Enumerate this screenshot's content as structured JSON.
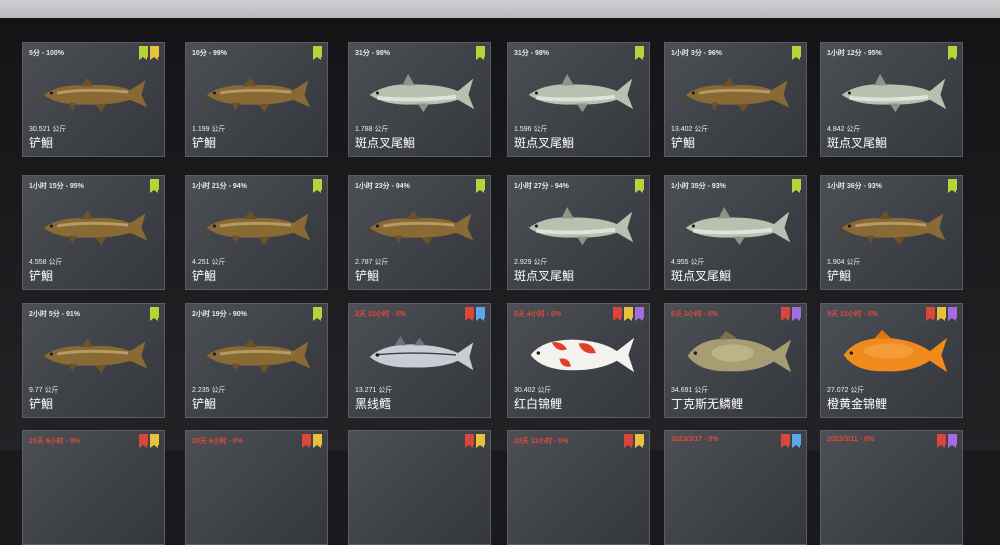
{
  "cards": [
    {
      "time": "5分 - 100%",
      "weight": "30.521 公斤",
      "name": "铲鮰",
      "fish": "catfish",
      "time_color": "white",
      "badges": [
        "green",
        "yellow"
      ]
    },
    {
      "time": "10分 - 99%",
      "weight": "1.199 公斤",
      "name": "铲鮰",
      "fish": "catfish",
      "time_color": "white",
      "badges": [
        "green"
      ]
    },
    {
      "time": "31分 - 98%",
      "weight": "1.788 公斤",
      "name": "斑点叉尾鮰",
      "fish": "channel-catfish",
      "time_color": "white",
      "badges": [
        "green"
      ]
    },
    {
      "time": "31分 - 98%",
      "weight": "1.596 公斤",
      "name": "斑点叉尾鮰",
      "fish": "channel-catfish",
      "time_color": "white",
      "badges": [
        "green"
      ]
    },
    {
      "time": "1小时 3分 - 96%",
      "weight": "13.402 公斤",
      "name": "铲鮰",
      "fish": "catfish",
      "time_color": "white",
      "badges": [
        "green"
      ]
    },
    {
      "time": "1小时 12分 - 95%",
      "weight": "4.842 公斤",
      "name": "斑点叉尾鮰",
      "fish": "channel-catfish",
      "time_color": "white",
      "badges": [
        "green"
      ]
    },
    {
      "time": "1小时 15分 - 95%",
      "weight": "4.558 公斤",
      "name": "铲鮰",
      "fish": "catfish",
      "time_color": "white",
      "badges": [
        "green"
      ]
    },
    {
      "time": "1小时 21分 - 94%",
      "weight": "4.251 公斤",
      "name": "铲鮰",
      "fish": "catfish",
      "time_color": "white",
      "badges": [
        "green"
      ]
    },
    {
      "time": "1小时 23分 - 94%",
      "weight": "2.787 公斤",
      "name": "铲鮰",
      "fish": "catfish",
      "time_color": "white",
      "badges": [
        "green"
      ]
    },
    {
      "time": "1小时 27分 - 94%",
      "weight": "2.929 公斤",
      "name": "斑点叉尾鮰",
      "fish": "channel-catfish",
      "time_color": "white",
      "badges": [
        "green"
      ]
    },
    {
      "time": "1小时 35分 - 93%",
      "weight": "4.955 公斤",
      "name": "斑点叉尾鮰",
      "fish": "channel-catfish",
      "time_color": "white",
      "badges": [
        "green"
      ]
    },
    {
      "time": "1小时 36分 - 93%",
      "weight": "1.904 公斤",
      "name": "铲鮰",
      "fish": "catfish",
      "time_color": "white",
      "badges": [
        "green"
      ]
    },
    {
      "time": "2小时 5分 - 91%",
      "weight": "9.77 公斤",
      "name": "铲鮰",
      "fish": "catfish",
      "time_color": "white",
      "badges": [
        "green"
      ]
    },
    {
      "time": "2小时 19分 - 90%",
      "weight": "2.235 公斤",
      "name": "铲鮰",
      "fish": "catfish",
      "time_color": "white",
      "badges": [
        "green"
      ]
    },
    {
      "time": "2天 10小时 - 0%",
      "weight": "13.271 公斤",
      "name": "黑线鳕",
      "fish": "haddock",
      "time_color": "red",
      "badges": [
        "red",
        "blue"
      ]
    },
    {
      "time": "5天 4小时 - 0%",
      "weight": "30.402 公斤",
      "name": "红白锦鲤",
      "fish": "koi",
      "time_color": "red",
      "badges": [
        "red",
        "yellow",
        "purple"
      ]
    },
    {
      "time": "6天 3小时 - 0%",
      "weight": "34.691 公斤",
      "name": "丁克斯无鳞鲤",
      "fish": "carp",
      "time_color": "red",
      "badges": [
        "red",
        "purple"
      ]
    },
    {
      "time": "9天 13小时 - 0%",
      "weight": "27.072 公斤",
      "name": "橙黄金锦鲤",
      "fish": "orange-koi",
      "time_color": "red",
      "badges": [
        "red",
        "yellow",
        "purple"
      ]
    },
    {
      "time": "20天 6小时 - 0%",
      "weight": "",
      "name": "",
      "fish": "none",
      "time_color": "red",
      "badges": [
        "red",
        "yellow"
      ]
    },
    {
      "time": "20天 6小时 - 0%",
      "weight": "",
      "name": "",
      "fish": "none",
      "time_color": "red",
      "badges": [
        "red",
        "yellow"
      ]
    },
    {
      "time": "",
      "weight": "",
      "name": "",
      "fish": "none",
      "time_color": "red",
      "badges": [
        "red",
        "yellow"
      ]
    },
    {
      "time": "20天 11小时 - 0%",
      "weight": "",
      "name": "",
      "fish": "none",
      "time_color": "red",
      "badges": [
        "red",
        "yellow"
      ]
    },
    {
      "time": "2023/3/17 - 0%",
      "weight": "",
      "name": "",
      "fish": "none",
      "time_color": "red",
      "badges": [
        "red",
        "blue"
      ]
    },
    {
      "time": "2023/3/11 - 0%",
      "weight": "",
      "name": "",
      "fish": "none",
      "time_color": "red",
      "badges": [
        "red",
        "purple"
      ]
    }
  ]
}
